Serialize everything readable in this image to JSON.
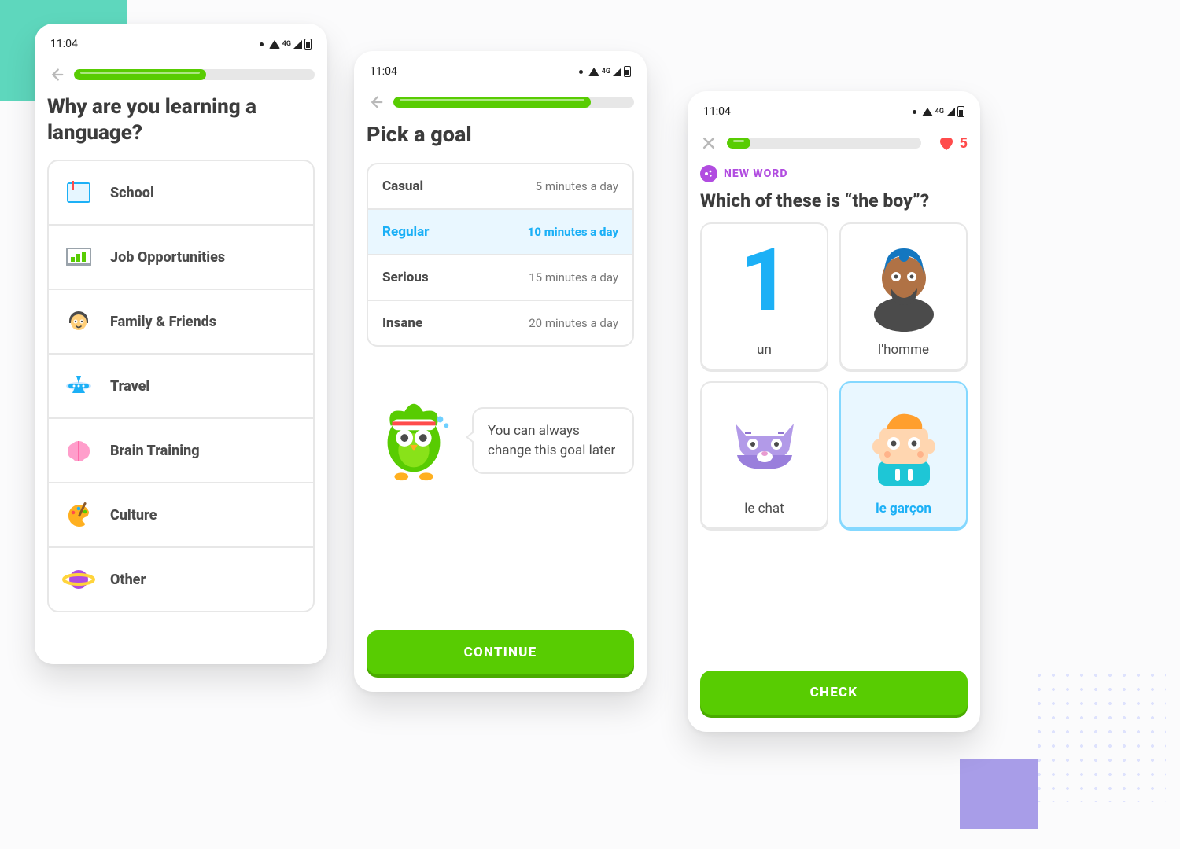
{
  "status": {
    "time": "11:04",
    "net": "4G"
  },
  "screen1": {
    "progress_pct": 55,
    "question": "Why are you learning a language?",
    "options": [
      {
        "label": "School",
        "icon": "book-icon"
      },
      {
        "label": "Job Opportunities",
        "icon": "chart-icon"
      },
      {
        "label": "Family & Friends",
        "icon": "family-icon"
      },
      {
        "label": "Travel",
        "icon": "plane-icon"
      },
      {
        "label": "Brain Training",
        "icon": "brain-icon"
      },
      {
        "label": "Culture",
        "icon": "palette-icon"
      },
      {
        "label": "Other",
        "icon": "planet-icon"
      }
    ]
  },
  "screen2": {
    "progress_pct": 82,
    "title": "Pick a goal",
    "goals": [
      {
        "name": "Casual",
        "desc": "5 minutes a day",
        "selected": false
      },
      {
        "name": "Regular",
        "desc": "10 minutes a day",
        "selected": true
      },
      {
        "name": "Serious",
        "desc": "15 minutes a day",
        "selected": false
      },
      {
        "name": "Insane",
        "desc": "20 minutes a day",
        "selected": false
      }
    ],
    "tip": "You can always change this goal later",
    "cta": "CONTINUE"
  },
  "screen3": {
    "progress_pct": 12,
    "hearts": "5",
    "pill": "NEW WORD",
    "prompt": "Which of these is “the boy”?",
    "cards": [
      {
        "label": "un",
        "icon": "number-one-icon",
        "selected": false
      },
      {
        "label": "l'homme",
        "icon": "man-icon",
        "selected": false
      },
      {
        "label": "le chat",
        "icon": "cat-icon",
        "selected": false
      },
      {
        "label": "le garçon",
        "icon": "boy-icon",
        "selected": true
      }
    ],
    "cta": "CHECK"
  }
}
